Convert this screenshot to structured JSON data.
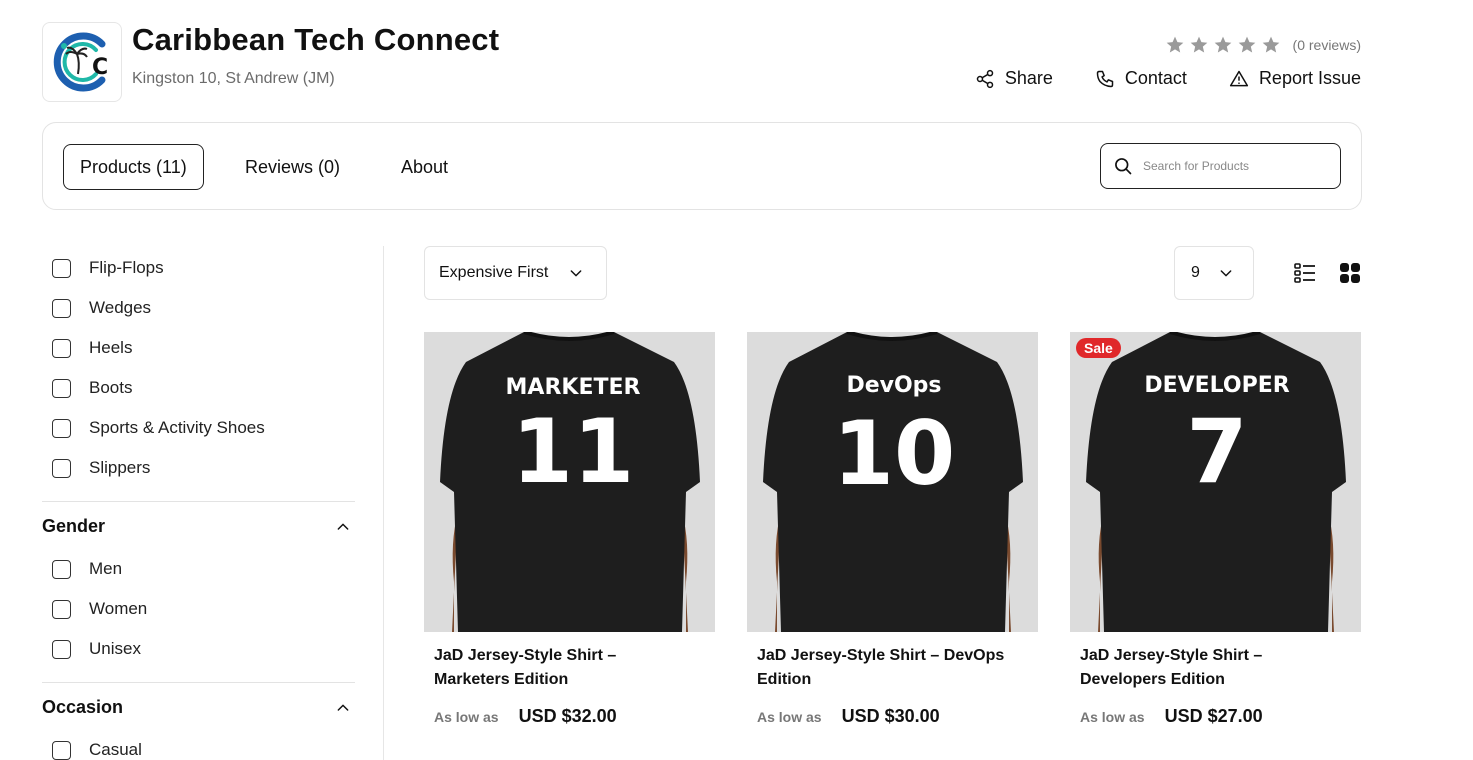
{
  "store": {
    "name": "Caribbean Tech Connect",
    "location": "Kingston 10, St Andrew (JM)",
    "logo_letter": "C"
  },
  "rating": {
    "stars": 5,
    "filled": 0,
    "reviews_text": "(0 reviews)"
  },
  "actions": {
    "share": "Share",
    "contact": "Contact",
    "report": "Report Issue"
  },
  "tabs": {
    "products": "Products (11)",
    "reviews": "Reviews (0)",
    "about": "About"
  },
  "search": {
    "placeholder": "Search for Products",
    "value": ""
  },
  "filters": {
    "categories": [
      "Flip-Flops",
      "Wedges",
      "Heels",
      "Boots",
      "Sports & Activity Shoes",
      "Slippers"
    ],
    "gender_title": "Gender",
    "gender": [
      "Men",
      "Women",
      "Unisex"
    ],
    "occasion_title": "Occasion",
    "occasion": [
      "Casual"
    ]
  },
  "sort": {
    "selected": "Expensive First"
  },
  "per_page": {
    "selected": "9"
  },
  "products": [
    {
      "title_line1": "JaD Jersey-Style Shirt –",
      "title_line2": "Marketers Edition",
      "price_label": "As low as",
      "price": "USD $32.00",
      "shirt_word": "MARKETER",
      "shirt_number": "11",
      "sale": ""
    },
    {
      "title_line1": "JaD Jersey-Style Shirt – DevOps",
      "title_line2": "Edition",
      "price_label": "As low as",
      "price": "USD $30.00",
      "shirt_word": "DevOps",
      "shirt_number": "10",
      "sale": ""
    },
    {
      "title_line1": "JaD Jersey-Style Shirt –",
      "title_line2": "Developers Edition",
      "price_label": "As low as",
      "price": "USD $27.00",
      "shirt_word": "DEVELOPER",
      "shirt_number": "7",
      "sale": "Sale"
    }
  ],
  "colors": {
    "accent_teal": "#1fb8a8",
    "accent_blue": "#1d5fb0",
    "sale_red": "#e0282a",
    "star_gray": "#9a9a9a"
  }
}
